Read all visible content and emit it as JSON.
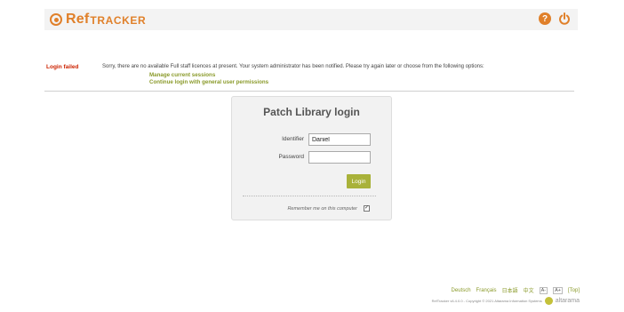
{
  "header": {
    "logo_ref": "Ref",
    "logo_tracker": "TRACKER",
    "help_glyph": "?",
    "icons": [
      "reftracker-logo-icon",
      "help-icon",
      "power-icon"
    ]
  },
  "error": {
    "label": "Login failed",
    "message": "Sorry, there are no available Full staff licences at present. Your system administrator has been notified. Please try again later or choose from the following options:",
    "links": [
      "Manage current sessions",
      "Continue login with general user permissions"
    ]
  },
  "login": {
    "title": "Patch Library login",
    "identifier_label": "Identifier",
    "identifier_value": "Daniel",
    "password_label": "Password",
    "password_value": "",
    "submit_label": "Login",
    "remember_label": "Remember me on this computer",
    "remember_checked": true
  },
  "footer": {
    "languages": [
      "Deutsch",
      "Français",
      "日本語",
      "中文"
    ],
    "font_smaller": "A-",
    "font_larger": "A+",
    "top_link": "[Top]",
    "copyright": "RefTracker v6.4.0.0 - Copyright © 2021 Altarama Information Systems",
    "brand": "altarama"
  },
  "colors": {
    "accent": "#e0802a",
    "link_green": "#8a9a2a",
    "button_green": "#a9b23a",
    "error_red": "#cc2200"
  }
}
